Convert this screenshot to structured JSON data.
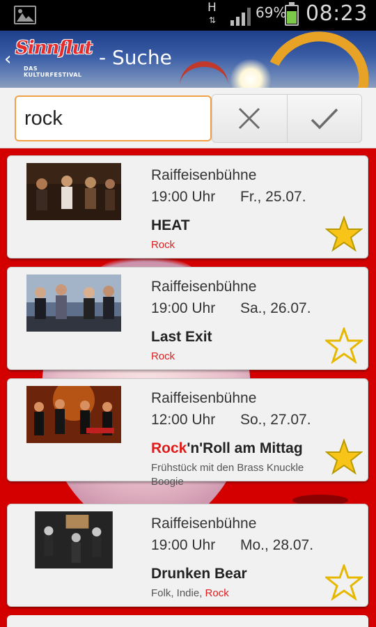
{
  "status_bar": {
    "network": "H",
    "battery_percent": "69%",
    "time": "08:23",
    "battery_level": 0.69,
    "icons": [
      "gallery-icon",
      "data-transfer-icon",
      "signal-icon",
      "battery-icon"
    ]
  },
  "action_bar": {
    "logo_text": "Sinnflut",
    "logo_subtitle": "DAS KULTURFESTIVAL",
    "title": "- Suche",
    "back_icon": "chevron-left-icon"
  },
  "search": {
    "value": "rock",
    "clear_icon": "close-icon",
    "confirm_icon": "checkmark-icon"
  },
  "colors": {
    "accent_red": "#e21b1b",
    "background_red": "#d40000",
    "star_gold": "#f7c417",
    "input_focus": "#f0a046"
  },
  "events": [
    {
      "venue": "Raiffeisenbühne",
      "time": "19:00 Uhr",
      "date": "Fr., 25.07.",
      "title": "HEAT",
      "title_highlight": "",
      "title_rest": "",
      "genre_prefix": "",
      "genre_highlight": "Rock",
      "favorite": true
    },
    {
      "venue": "Raiffeisenbühne",
      "time": "19:00 Uhr",
      "date": "Sa., 26.07.",
      "title": "Last Exit",
      "title_highlight": "",
      "title_rest": "",
      "genre_prefix": "",
      "genre_highlight": "Rock",
      "favorite": false
    },
    {
      "venue": "Raiffeisenbühne",
      "time": "12:00 Uhr",
      "date": "So., 27.07.",
      "title": "",
      "title_highlight": "Rock",
      "title_rest": "'n'Roll am Mittag",
      "subtitle": "Frühstück mit den Brass Knuckle Boogie",
      "favorite": true
    },
    {
      "venue": "Raiffeisenbühne",
      "time": "19:00 Uhr",
      "date": "Mo., 28.07.",
      "title": "Drunken Bear",
      "title_highlight": "",
      "title_rest": "",
      "genre_prefix": "Folk, Indie, ",
      "genre_highlight": "Rock",
      "favorite": false
    }
  ]
}
